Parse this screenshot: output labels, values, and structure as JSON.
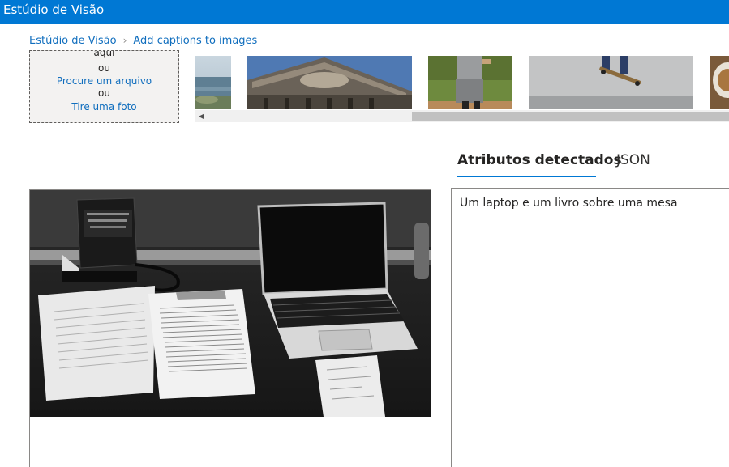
{
  "app": {
    "title": "Estúdio de Visão"
  },
  "breadcrumb": {
    "home": "Estúdio de Visão",
    "separator": "›",
    "current": "Add captions to images"
  },
  "upload": {
    "line1": "aqui",
    "or1": "ou",
    "browse": "Procure um arquivo",
    "or2": "ou",
    "camera": "Tire uma foto"
  },
  "gallery": {
    "thumbnails": [
      "ocean-shore",
      "building-facade",
      "baseball-player",
      "skateboarder",
      "food-plate"
    ]
  },
  "tabs": {
    "attributes": "Atributos detectados",
    "json": "JSON"
  },
  "result": {
    "caption": "Um laptop e um livro sobre uma mesa"
  },
  "colors": {
    "accent": "#0078d4",
    "link": "#106ebe"
  }
}
